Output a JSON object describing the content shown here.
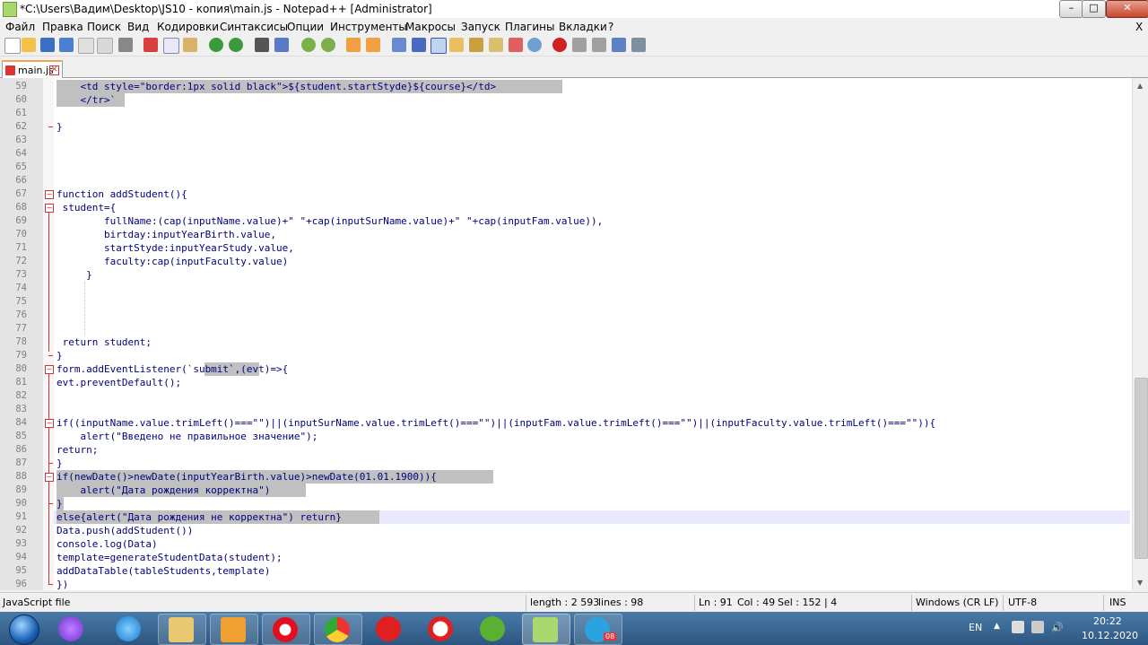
{
  "window": {
    "title": "*C:\\Users\\Вадим\\Desktop\\JS10 - копия\\main.js - Notepad++ [Administrator]",
    "min_label": "–",
    "max_label": "□",
    "close_label": "✕"
  },
  "menu": {
    "items": [
      "Файл",
      "Правка",
      "Поиск",
      "Вид",
      "Кодировки",
      "Синтаксисы",
      "Опции",
      "Инструменты",
      "Макросы",
      "Запуск",
      "Плагины",
      "Вкладки",
      "?"
    ],
    "close_doc": "X"
  },
  "tabs": [
    {
      "label": "main.js",
      "close": "✕"
    }
  ],
  "editor": {
    "lines": [
      {
        "n": "59",
        "code": "    <td style=\"border:1px solid black\">${student.startStyde}${course}</td>"
      },
      {
        "n": "60",
        "code": "    </tr>`"
      },
      {
        "n": "61",
        "code": ""
      },
      {
        "n": "62",
        "code": "}"
      },
      {
        "n": "63",
        "code": ""
      },
      {
        "n": "64",
        "code": ""
      },
      {
        "n": "65",
        "code": ""
      },
      {
        "n": "66",
        "code": ""
      },
      {
        "n": "67",
        "code": "function addStudent(){"
      },
      {
        "n": "68",
        "code": " student={"
      },
      {
        "n": "69",
        "code": "        fullName:(cap(inputName.value)+\" \"+cap(inputSurName.value)+\" \"+cap(inputFam.value)),"
      },
      {
        "n": "70",
        "code": "        birtday:inputYearBirth.value,"
      },
      {
        "n": "71",
        "code": "        startStyde:inputYearStudy.value,"
      },
      {
        "n": "72",
        "code": "        faculty:cap(inputFaculty.value)"
      },
      {
        "n": "73",
        "code": "     }"
      },
      {
        "n": "74",
        "code": ""
      },
      {
        "n": "75",
        "code": ""
      },
      {
        "n": "76",
        "code": ""
      },
      {
        "n": "77",
        "code": ""
      },
      {
        "n": "78",
        "code": " return student;"
      },
      {
        "n": "79",
        "code": "}"
      },
      {
        "n": "80",
        "code": "form.addEventListener(`submit`,(evt)=>{"
      },
      {
        "n": "81",
        "code": "evt.preventDefault();"
      },
      {
        "n": "82",
        "code": ""
      },
      {
        "n": "83",
        "code": ""
      },
      {
        "n": "84",
        "code": "if((inputName.value.trimLeft()===\"\")||(inputSurName.value.trimLeft()===\"\")||(inputFam.value.trimLeft()===\"\")||(inputFaculty.value.trimLeft()===\"\")){"
      },
      {
        "n": "85",
        "code": "    alert(\"Введено не правильное значение\");"
      },
      {
        "n": "86",
        "code": "return;"
      },
      {
        "n": "87",
        "code": "}"
      },
      {
        "n": "88",
        "code": "if(newDate()>newDate(inputYearBirth.value)>newDate(01.01.1900)){"
      },
      {
        "n": "89",
        "code": "    alert(\"Дата рождения корректна\")"
      },
      {
        "n": "90",
        "code": "}"
      },
      {
        "n": "91",
        "code": "else{alert(\"Дата рождения не корректна\") return}"
      },
      {
        "n": "92",
        "code": "Data.push(addStudent())"
      },
      {
        "n": "93",
        "code": "console.log(Data)"
      },
      {
        "n": "94",
        "code": "template=generateStudentData(student);"
      },
      {
        "n": "95",
        "code": "addDataTable(tableStudents,template)"
      },
      {
        "n": "96",
        "code": "})"
      }
    ]
  },
  "status": {
    "filetype": "JavaScript file",
    "length": "length : 2 593",
    "lines": "lines : 98",
    "ln": "Ln : 91",
    "col": "Col : 49",
    "sel": "Sel : 152 | 4",
    "eol": "Windows (CR LF)",
    "encoding": "UTF-8",
    "mode": "INS"
  },
  "taskbar": {
    "apps": [
      "windows-start",
      "alisa",
      "internet-explorer",
      "file-explorer",
      "video-player",
      "opera",
      "chrome",
      "yandex",
      "yandex-browser",
      "utorrent",
      "notepad-plus-plus",
      "telegram"
    ],
    "telegram_badge": "08",
    "lang": "EN",
    "time": "20:22",
    "date": "10.12.2020"
  }
}
